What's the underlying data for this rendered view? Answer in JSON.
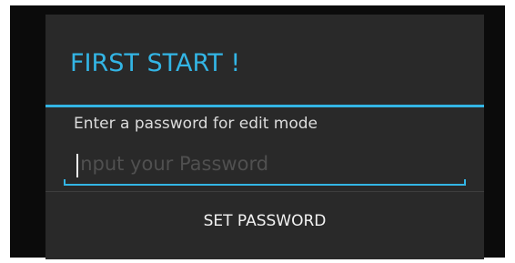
{
  "dialog": {
    "title": "FIRST START !",
    "prompt": "Enter a password for edit mode",
    "password_field": {
      "value": "",
      "placeholder": "Input your Password"
    },
    "set_password_label": "SET PASSWORD"
  },
  "colors": {
    "accent": "#33b5e5",
    "dialog_background": "#292929",
    "backdrop": "#0b0b0b"
  }
}
